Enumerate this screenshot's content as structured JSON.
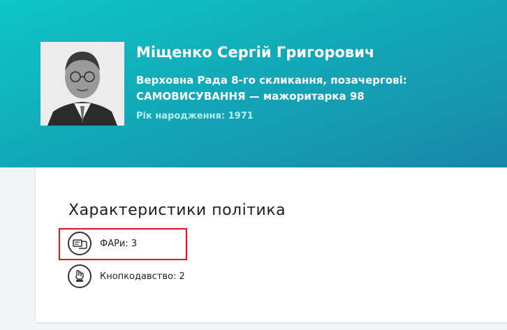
{
  "profile": {
    "name": "Міщенко Сергій Григорович",
    "convocation": "Верховна Рада 8-го скликання, позачергові:",
    "district": "САМОВИСУВАННЯ — мажоритарка 98",
    "birth_year": "Рік народження: 1971"
  },
  "characteristics": {
    "title": "Характеристики політика",
    "items": [
      {
        "label": "ФАРи: 3",
        "icon": "hand-card-icon"
      },
      {
        "label": "Кнопкодавство: 2",
        "icon": "hand-press-button-icon"
      }
    ]
  },
  "colors": {
    "header_gradient_start": "#0fc6c6",
    "header_gradient_end": "#1a87a8",
    "highlight_border": "#e0141e"
  }
}
